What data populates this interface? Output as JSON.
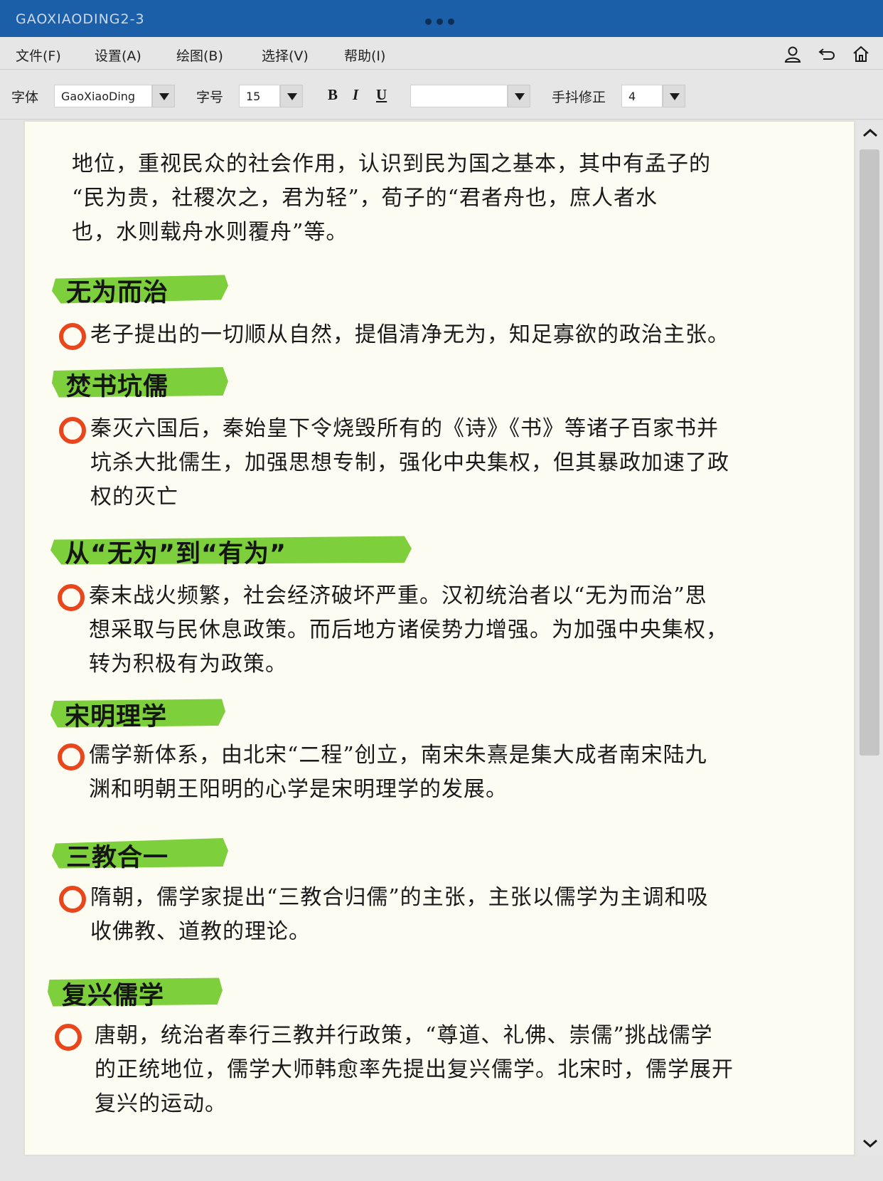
{
  "window": {
    "title": "GAOXIAODING2-3"
  },
  "menu": {
    "items": [
      {
        "label": "文件(F)"
      },
      {
        "label": "设置(A)"
      },
      {
        "label": "绘图(B)"
      },
      {
        "label": "选择(V)"
      },
      {
        "label": "帮助(I)"
      }
    ],
    "icons": [
      "user-icon",
      "undo-icon",
      "home-icon"
    ]
  },
  "toolbar": {
    "font_label": "字体",
    "font_value": "GaoXiaoDing",
    "size_label": "字号",
    "size_value": "15",
    "bold": "B",
    "italic": "I",
    "underline": "U",
    "color_value": "",
    "jitter_label": "手抖修正",
    "jitter_value": "4"
  },
  "colors": {
    "highlight": "#7dcf3c",
    "bullet": "#e9461c",
    "titlebar": "#1b5fa8",
    "paper": "#fdfcf2"
  },
  "document": {
    "intro": [
      "地位，重视民众的社会作用，认识到民为国之基本，其中有孟子的",
      "“民为贵，社稷次之，君为轻”，荀子的“君者舟也，庶人者水",
      "也，水则载舟水则覆舟”等。"
    ],
    "sections": [
      {
        "heading": "无为而治",
        "lines": [
          "老子提出的一切顺从自然，提倡清净无为，知足寡欲的政治主张。"
        ]
      },
      {
        "heading": "焚书坑儒",
        "lines": [
          "秦灭六国后，秦始皇下令烧毁所有的《诗》《书》等诸子百家书并",
          "坑杀大批儒生，加强思想专制，强化中央集权，但其暴政加速了政",
          "权的灭亡"
        ]
      },
      {
        "heading": "从“无为”到“有为”",
        "lines": [
          "秦末战火频繁，社会经济破坏严重。汉初统治者以“无为而治”思",
          "想采取与民休息政策。而后地方诸侯势力增强。为加强中央集权，",
          "转为积极有为政策。"
        ]
      },
      {
        "heading": "宋明理学",
        "lines": [
          "儒学新体系，由北宋“二程”创立，南宋朱熹是集大成者南宋陆九",
          "渊和明朝王阳明的心学是宋明理学的发展。"
        ]
      },
      {
        "heading": "三教合一",
        "lines": [
          "隋朝，儒学家提出“三教合归儒”的主张，主张以儒学为主调和吸",
          "收佛教、道教的理论。"
        ]
      },
      {
        "heading": "复兴儒学",
        "lines": [
          "唐朝，统治者奉行三教并行政策，“尊道、礼佛、崇儒”挑战儒学",
          "的正统地位，儒学大师韩愈率先提出复兴儒学。北宋时，儒学展开",
          "复兴的运动。"
        ]
      }
    ]
  }
}
